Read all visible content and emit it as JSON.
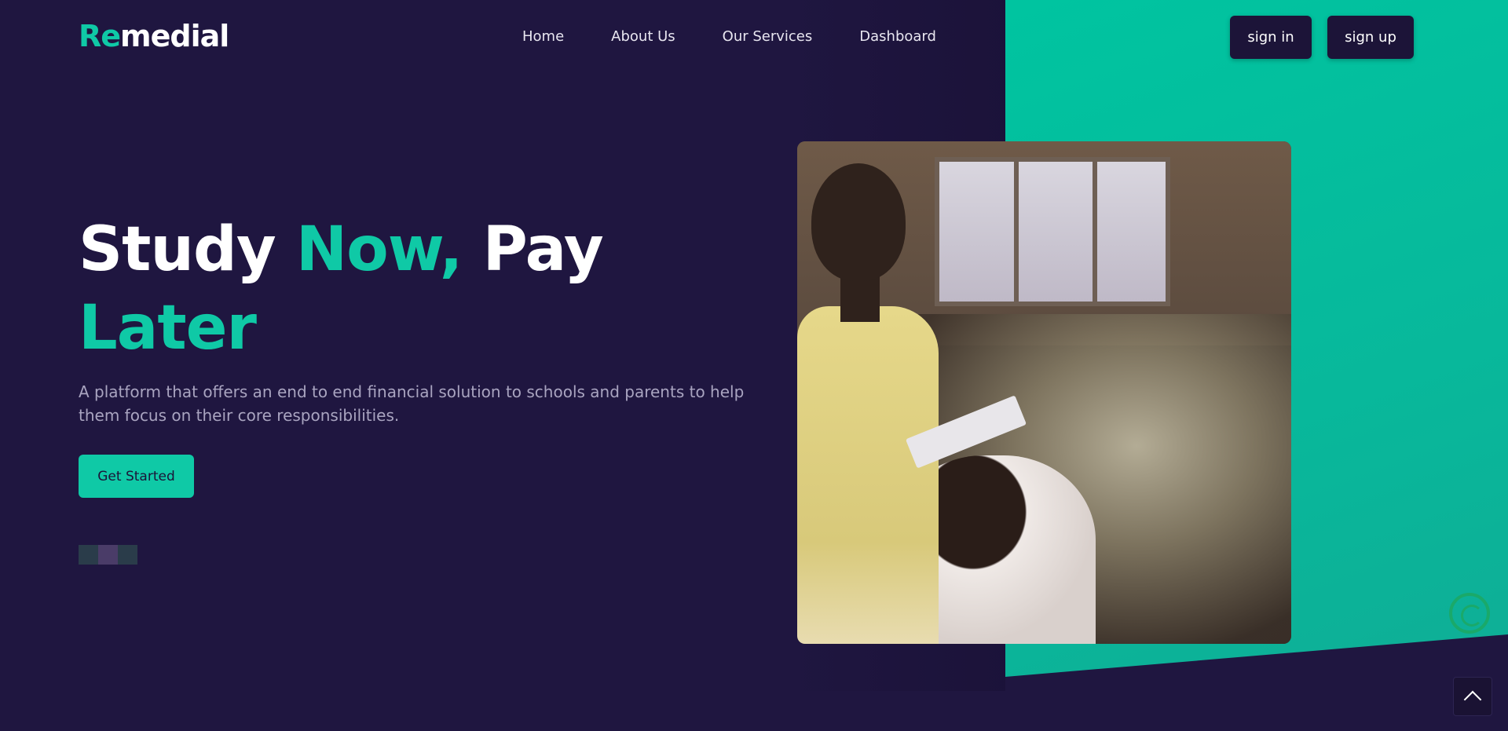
{
  "brand": {
    "part1": "Re",
    "part2": "medial"
  },
  "nav": {
    "items": [
      "Home",
      "About Us",
      "Our Services",
      "Dashboard"
    ]
  },
  "auth": {
    "signin_label": "sign in",
    "signup_label": "sign up"
  },
  "hero": {
    "title_word1": "Study",
    "title_word2": "Now,",
    "title_word3": "Pay",
    "title_word4": "Later",
    "description": "A platform that offers an end to end financial solution to schools and parents to help them focus on their core responsibilities.",
    "cta_label": "Get Started"
  },
  "colors": {
    "background": "#1f1640",
    "accent": "#0fc9a6",
    "button_dark": "#1c1438",
    "text_muted": "#a9a4c0",
    "whatsapp": "#1aa96a"
  },
  "icons": {
    "whatsapp": "whatsapp-icon",
    "scroll_top": "chevron-up-icon"
  },
  "pixel_strip": [
    "#2a3c4a",
    "#4a3c68",
    "#2a3c4a"
  ]
}
